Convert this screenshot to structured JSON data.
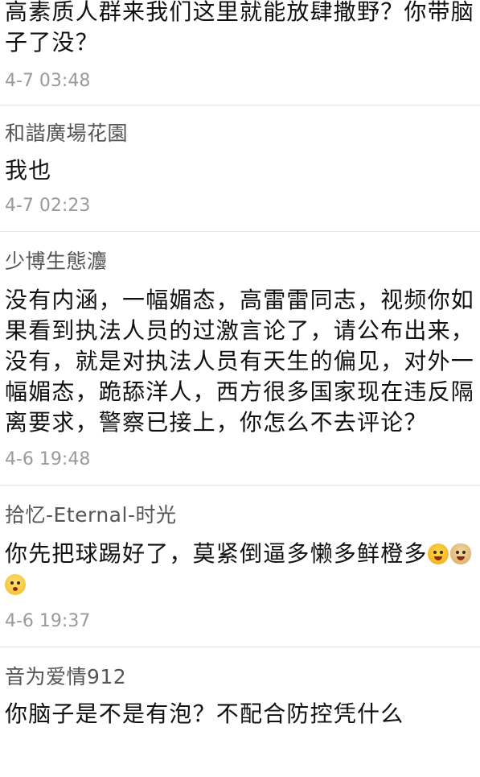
{
  "comments": [
    {
      "username": "",
      "content": "高素质人群来我们这里就能放肆撒野？你带脑子了没？",
      "time": "4-7 03:48"
    },
    {
      "username": "和諧廣場花園",
      "content": "我也",
      "time": "4-7 02:23"
    },
    {
      "username": "少博生態灋",
      "content": "没有内涵，一幅媚态，高雷雷同志，视频你如果看到执法人员的过激言论了，请公布出来，没有，就是对执法人员有天生的偏见，对外一幅媚态，跪舔洋人，西方很多国家现在违反隔离要求，警察已接上，你怎么不去评论？",
      "time": "4-6 19:48"
    },
    {
      "username": "拾忆-Eternal-时光",
      "content": "你先把球踢好了，莫紧倒逼多懒多鲜橙多",
      "emojis": [
        "angry-face-icon",
        "doge-icon",
        "thinking-face-icon"
      ],
      "time": "4-6 19:37"
    },
    {
      "username": "音为爱情912",
      "content": "你脑子是不是有泡？不配合防控凭什么",
      "time": ""
    }
  ]
}
